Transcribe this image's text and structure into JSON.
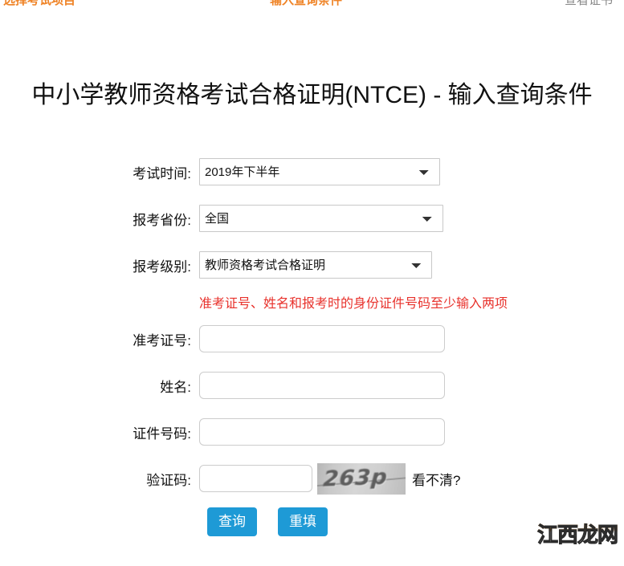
{
  "steps": [
    {
      "label": "选择考试项目",
      "state": "done"
    },
    {
      "label": "输入查询条件",
      "state": "active"
    },
    {
      "label": "查看证书",
      "state": "todo"
    }
  ],
  "page_title": "中小学教师资格考试合格证明(NTCE) - 输入查询条件",
  "form": {
    "exam_time": {
      "label": "考试时间:",
      "value": "2019年下半年",
      "options": [
        "2019年下半年"
      ]
    },
    "province": {
      "label": "报考省份:",
      "value": "全国",
      "options": [
        "全国"
      ]
    },
    "level": {
      "label": "报考级别:",
      "value": "教师资格考试合格证明",
      "options": [
        "教师资格考试合格证明"
      ]
    },
    "notice": "准考证号、姓名和报考时的身份证件号码至少输入两项",
    "admission_ticket": {
      "label": "准考证号:",
      "value": "",
      "placeholder": ""
    },
    "name": {
      "label": "姓名:",
      "value": "",
      "placeholder": ""
    },
    "id_number": {
      "label": "证件号码:",
      "value": "",
      "placeholder": ""
    },
    "captcha": {
      "label": "验证码:",
      "value": "",
      "placeholder": "",
      "image_text": "263p",
      "refresh_label": "看不清?"
    }
  },
  "buttons": {
    "submit": "查询",
    "reset": "重填"
  },
  "watermark": "江西龙网",
  "colors": {
    "step_active": "#ef8326",
    "step_todo": "#888888",
    "notice_red": "#e8322c",
    "button_blue": "#1e9ad6"
  }
}
